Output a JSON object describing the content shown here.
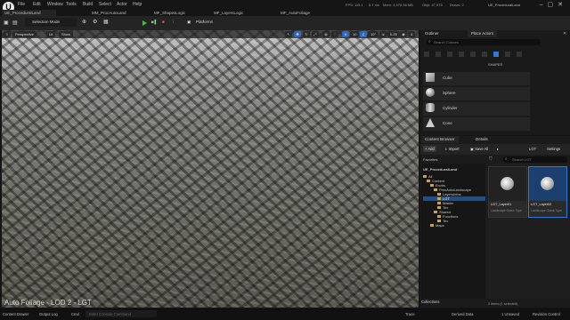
{
  "app": {
    "logo": "U",
    "project": "UE_ProceduralLand",
    "menu": [
      "File",
      "Edit",
      "Window",
      "Tools",
      "Build",
      "Select",
      "Actor",
      "Help"
    ],
    "tabs": [
      "UE_ProceduralLand",
      "MM_ProcAutoLand",
      "MF_ShapesLogic",
      "MF_LayersLogic",
      "MF_AutoFoliage"
    ],
    "stats": {
      "fps": "FPS: 115.1",
      "ms": "8.7 ms",
      "mem": "Mem: 3,978.36 MB",
      "objs": "Objs: 47,975",
      "draws": "Draws: 2"
    }
  },
  "toolbar": {
    "selection_mode": "Selection Mode",
    "platforms": "Platforms"
  },
  "viewport": {
    "perspective": "Perspective",
    "lit": "Lit",
    "show": "Show",
    "grid_snap": "10",
    "rot_snap": "10°",
    "scale_snap": "0.25",
    "camera_speed": "4",
    "overlay": "Auto Foliage - LOD 2 - LGT"
  },
  "outliner": {
    "tab_outliner": "Outliner",
    "tab_place": "Place Actors",
    "search_placeholder": "Search Classes",
    "shapes_label": "SHAPES",
    "shapes": [
      "Cube",
      "Sphere",
      "Cylinder",
      "Cone"
    ]
  },
  "content_browser": {
    "tab": "Content Browser",
    "details_tab": "Details",
    "add": "Add",
    "import": "Import",
    "save_all": "Save All",
    "path": "LGT",
    "search_placeholder": "Search LGT",
    "settings": "Settings",
    "favorites": "Favorites",
    "project": "UE_ProceduralLand",
    "tree": [
      {
        "label": "All",
        "depth": 0
      },
      {
        "label": "Content",
        "depth": 1
      },
      {
        "label": "Envirs",
        "depth": 2
      },
      {
        "label": "ProcAutoLandscape",
        "depth": 3
      },
      {
        "label": "LayersInfos",
        "depth": 4
      },
      {
        "label": "LGT",
        "depth": 4,
        "selected": true
      },
      {
        "label": "Master",
        "depth": 4
      },
      {
        "label": "Tex",
        "depth": 4
      },
      {
        "label": "Shared",
        "depth": 3
      },
      {
        "label": "Functions",
        "depth": 4
      },
      {
        "label": "Tex",
        "depth": 4
      },
      {
        "label": "Maps",
        "depth": 2
      }
    ],
    "assets": [
      {
        "name": "LGT_Layer01",
        "type": "Landscape Grass Type"
      },
      {
        "name": "LGT_Layer02",
        "type": "Landscape Grass Type",
        "selected": true
      }
    ],
    "collections": "Collections",
    "items_count": "2 items (1 selected)"
  },
  "statusbar": {
    "content_drawer": "Content Drawer",
    "output_log": "Output Log",
    "cmd": "Cmd",
    "cmd_placeholder": "Enter Console Command",
    "trace": "Trace",
    "derived_data": "Derived Data",
    "unsaved": "1 Unsaved",
    "revision_control": "Revision Control"
  },
  "colors": {
    "accent": "#2c7ad6",
    "play": "#3ec43e",
    "folder": "#c9a24c"
  }
}
